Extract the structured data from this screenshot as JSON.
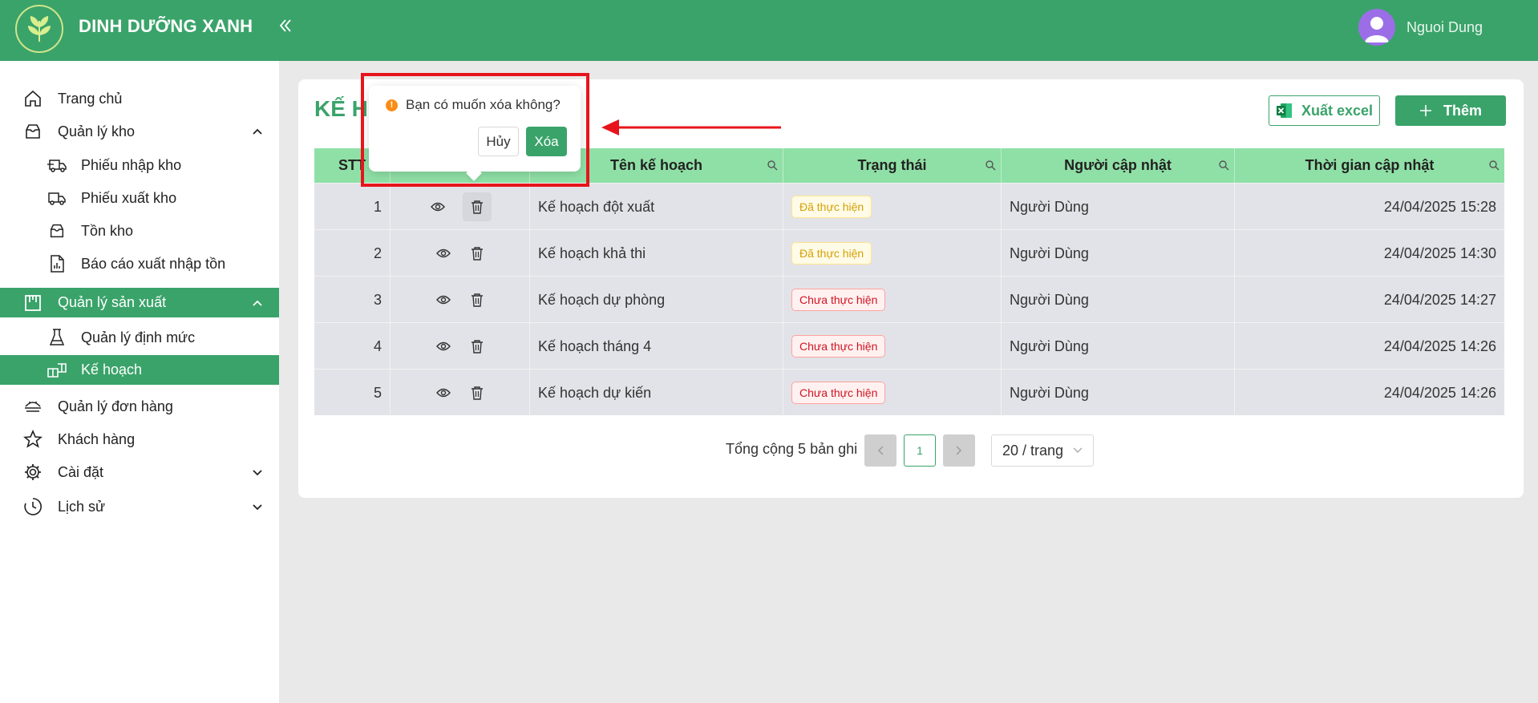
{
  "header": {
    "brand": "DINH DƯỠNG XANH",
    "collapse_icon": "double-chevron-left-icon",
    "user_name": "Nguoi Dung"
  },
  "sidebar": {
    "items": [
      {
        "label": "Trang chủ",
        "icon": "home-icon"
      },
      {
        "label": "Quản lý kho",
        "icon": "inbox-icon",
        "expanded": true
      },
      {
        "label": "Phiếu nhập kho",
        "icon": "truck-in-icon"
      },
      {
        "label": "Phiếu xuất kho",
        "icon": "truck-out-icon"
      },
      {
        "label": "Tồn kho",
        "icon": "inbox-icon"
      },
      {
        "label": "Báo cáo xuất nhập tồn",
        "icon": "report-icon"
      },
      {
        "label": "Quản lý sản xuất",
        "icon": "factory-icon",
        "expanded": true,
        "active": true
      },
      {
        "label": "Quản lý định mức",
        "icon": "flask-icon"
      },
      {
        "label": "Kế hoạch",
        "icon": "blocks-icon",
        "active": true
      },
      {
        "label": "Quản lý đơn hàng",
        "icon": "orders-icon"
      },
      {
        "label": "Khách hàng",
        "icon": "star-icon"
      },
      {
        "label": "Cài đặt",
        "icon": "gear-icon",
        "expanded": false
      },
      {
        "label": "Lịch sử",
        "icon": "history-icon",
        "expanded": false
      }
    ]
  },
  "page": {
    "title": "KẾ H",
    "export_label": "Xuất excel",
    "add_label": "Thêm"
  },
  "table": {
    "columns": [
      "STT",
      "Tên kế hoạch",
      "Trạng thái",
      "Người cập nhật",
      "Thời gian cập nhật"
    ],
    "columns_visible_stt": "STT",
    "rows": [
      {
        "stt": "1",
        "name": "Kế hoạch đột xuất",
        "status": "Đã thực hiện",
        "status_type": "done",
        "user": "Người Dùng",
        "time": "24/04/2025 15:28"
      },
      {
        "stt": "2",
        "name": "Kế hoạch khả thi",
        "status": "Đã thực hiện",
        "status_type": "done",
        "user": "Người Dùng",
        "time": "24/04/2025 14:30"
      },
      {
        "stt": "3",
        "name": "Kế hoạch dự phòng",
        "status": "Chưa thực hiện",
        "status_type": "todo",
        "user": "Người Dùng",
        "time": "24/04/2025 14:27"
      },
      {
        "stt": "4",
        "name": "Kế hoạch tháng 4",
        "status": "Chưa thực hiện",
        "status_type": "todo",
        "user": "Người Dùng",
        "time": "24/04/2025 14:26"
      },
      {
        "stt": "5",
        "name": "Kế hoạch dự kiến",
        "status": "Chưa thực hiện",
        "status_type": "todo",
        "user": "Người Dùng",
        "time": "24/04/2025 14:26"
      }
    ]
  },
  "pagination": {
    "total_text": "Tổng cộng 5 bản ghi",
    "current_page": "1",
    "page_size": "20 / trang"
  },
  "popconfirm": {
    "message": "Bạn có muốn xóa không?",
    "cancel_label": "Hủy",
    "ok_label": "Xóa"
  },
  "colors": {
    "primary": "#3aa36a",
    "table_header": "#8fe0a6",
    "annotation": "#e8141c"
  }
}
